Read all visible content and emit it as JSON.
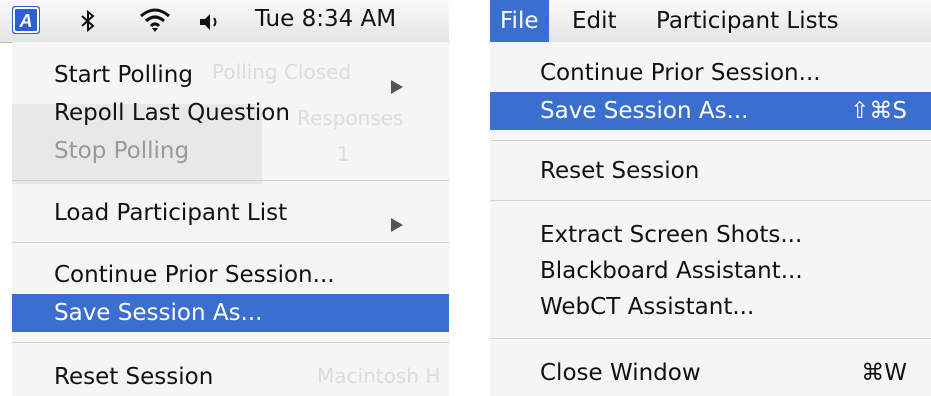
{
  "left_panel": {
    "menubar": {
      "app_icon_letter": "A",
      "icons": [
        "bluetooth-icon",
        "wifi-icon",
        "volume-icon"
      ],
      "clock": "Tue 8:34 AM"
    },
    "menu_items": [
      {
        "label": "Start Polling",
        "state": "normal",
        "submenu": true
      },
      {
        "label": "Repoll Last Question",
        "state": "normal",
        "submenu": false
      },
      {
        "label": "Stop Polling",
        "state": "disabled",
        "submenu": false
      },
      {
        "label": "Load Participant List",
        "state": "normal",
        "submenu": true
      },
      {
        "label": "Continue Prior Session...",
        "state": "normal",
        "submenu": false
      },
      {
        "label": "Save Session As...",
        "state": "selected",
        "submenu": false
      },
      {
        "label": "Reset Session",
        "state": "normal",
        "submenu": false
      }
    ],
    "background_ghost_text": [
      "Polling Closed",
      "Responses",
      "1",
      "Macintosh H"
    ]
  },
  "right_panel": {
    "menubar": {
      "items": [
        "File",
        "Edit",
        "Participant Lists"
      ],
      "selected": "File"
    },
    "menu_items": [
      {
        "label": "Continue Prior Session...",
        "shortcut": "",
        "state": "normal"
      },
      {
        "label": "Save Session As...",
        "shortcut": "⇧⌘S",
        "state": "selected"
      },
      {
        "label": "Reset Session",
        "shortcut": "",
        "state": "normal"
      },
      {
        "label": "Extract Screen Shots...",
        "shortcut": "",
        "state": "normal"
      },
      {
        "label": "Blackboard Assistant...",
        "shortcut": "",
        "state": "normal"
      },
      {
        "label": "WebCT Assistant...",
        "shortcut": "",
        "state": "normal"
      },
      {
        "label": "Close Window",
        "shortcut": "⌘W",
        "state": "normal"
      }
    ]
  },
  "colors": {
    "selection": "#3a6fd0",
    "app_icon": "#2b5fd3",
    "disabled_text": "#9a9a9a"
  }
}
